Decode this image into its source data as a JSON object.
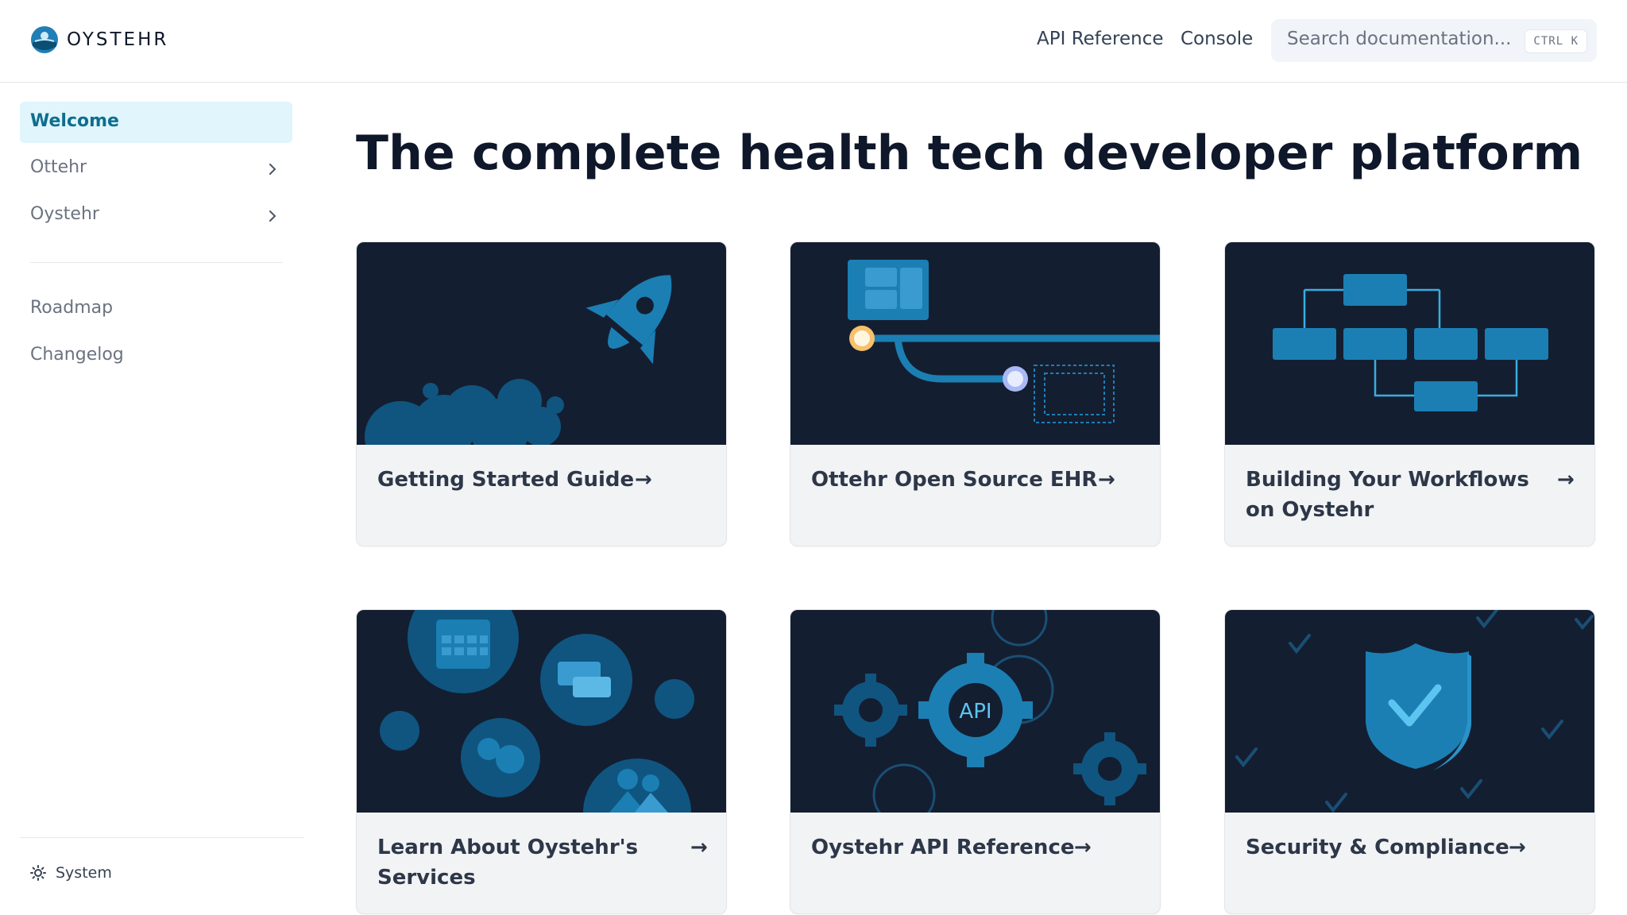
{
  "header": {
    "brand": "OYSTEHR",
    "nav": [
      "API Reference",
      "Console"
    ],
    "search_placeholder": "Search documentation...",
    "search_shortcut": "CTRL K"
  },
  "sidebar": {
    "items": [
      {
        "label": "Welcome",
        "active": true
      },
      {
        "label": "Ottehr",
        "expandable": true
      },
      {
        "label": "Oystehr",
        "expandable": true
      },
      {
        "label": "Roadmap"
      },
      {
        "label": "Changelog"
      }
    ],
    "theme_label": "System"
  },
  "main": {
    "title": "The complete health tech developer platform",
    "cards": [
      {
        "title": "Getting Started Guide",
        "arrow": "→",
        "icon": "rocket-illustration"
      },
      {
        "title": "Ottehr Open Source EHR",
        "arrow": "→",
        "icon": "ehr-flow-illustration"
      },
      {
        "title": "Building Your Workflows on Oystehr",
        "arrow": "→",
        "icon": "workflow-diagram-illustration"
      },
      {
        "title": "Learn About Oystehr's Services",
        "arrow": "→",
        "icon": "services-illustration"
      },
      {
        "title": "Oystehr API Reference",
        "arrow": "→",
        "icon": "api-gears-illustration"
      },
      {
        "title": "Security & Compliance",
        "arrow": "→",
        "icon": "shield-check-illustration"
      }
    ]
  },
  "colors": {
    "accent": "#0e6e8e",
    "active_bg": "#e0f5fc",
    "card_image_bg": "#141e31",
    "illustration_blue": "#1b7fb3"
  }
}
